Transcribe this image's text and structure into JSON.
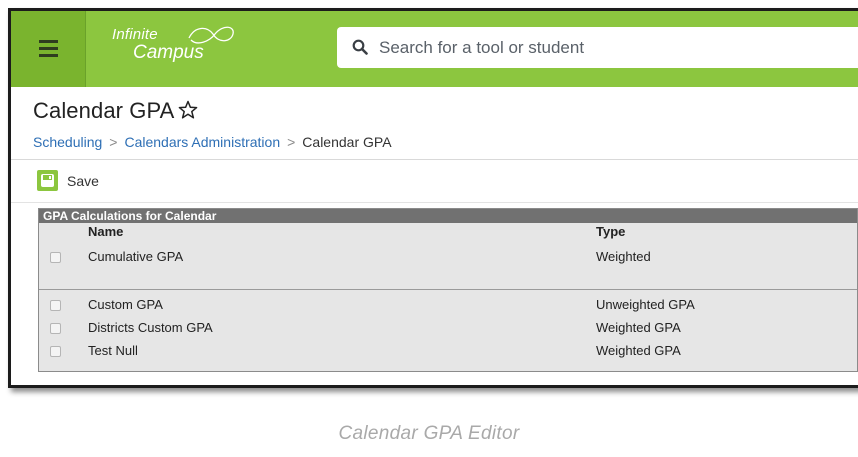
{
  "header": {
    "logo_line1": "Infinite",
    "logo_line2": "Campus",
    "search_placeholder": "Search for a tool or student"
  },
  "page": {
    "title": "Calendar GPA",
    "breadcrumb": [
      "Scheduling",
      "Calendars Administration",
      "Calendar GPA"
    ]
  },
  "toolbar": {
    "save_label": "Save"
  },
  "gpa_table": {
    "heading": "GPA Calculations for Calendar",
    "columns": {
      "name": "Name",
      "type": "Type"
    },
    "rows": [
      {
        "name": "Cumulative GPA",
        "type": "Weighted"
      },
      {
        "name": "Custom GPA",
        "type": "Unweighted GPA"
      },
      {
        "name": "Districts Custom GPA",
        "type": "Weighted GPA"
      },
      {
        "name": "Test Null",
        "type": "Weighted GPA"
      }
    ]
  },
  "caption": "Calendar GPA Editor",
  "colors": {
    "brand_green": "#8cc63f",
    "link_blue": "#2e6fb5",
    "table_header_gray": "#717171"
  },
  "icons": [
    "menu-icon",
    "infinity-icon",
    "search-icon",
    "star-icon",
    "save-icon",
    "checkbox"
  ]
}
